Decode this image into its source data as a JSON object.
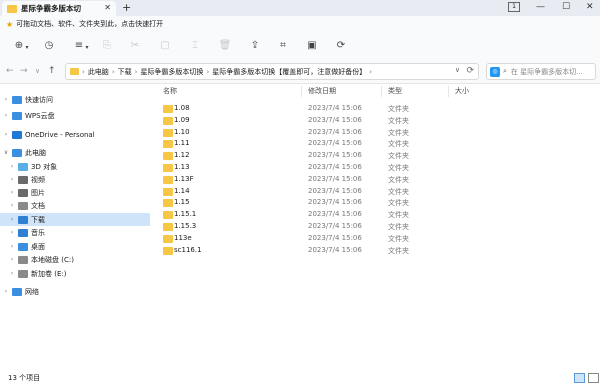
{
  "window": {
    "tab_title": "星际争霸多版本切",
    "tab_close": "✕",
    "new_tab": "+",
    "badge": "1",
    "minimize": "—",
    "maximize": "☐",
    "close": "✕"
  },
  "tip": {
    "text": "可拖动文档、软件、文件夹到此，点击快速打开"
  },
  "toolbar": {
    "icons": [
      "new-icon",
      "recent-icon",
      "view-icon",
      "copy-icon",
      "cut-icon",
      "paste-icon",
      "rename-icon",
      "delete-icon",
      "share-icon",
      "crop-icon",
      "save-icon",
      "refresh-icon"
    ]
  },
  "address": {
    "back": "←",
    "forward": "→",
    "dropdown": "∨",
    "up": "↑",
    "crumbs": [
      "此电脑",
      "下载",
      "星际争霸多版本切换",
      "星际争霸多版本切换【覆盖即可，注意做好备份】"
    ],
    "sep": "›",
    "search_placeholder": "在 星际争霸多版本切..."
  },
  "sidebar": {
    "items": [
      {
        "label": "快速访问",
        "level": 0,
        "icon": "star-icon",
        "color": "#3b8fe0"
      },
      {
        "label": "WPS云盘",
        "level": 0,
        "icon": "cloud-icon",
        "color": "#3b8fe0"
      },
      {
        "label": "OneDrive - Personal",
        "level": 0,
        "icon": "onedrive-icon",
        "color": "#1d7ad6"
      },
      {
        "label": "此电脑",
        "level": 0,
        "icon": "pc-icon",
        "color": "#3b8fe0",
        "expanded": true
      },
      {
        "label": "3D 对象",
        "level": 1,
        "icon": "3d-icon",
        "color": "#5ab0e6"
      },
      {
        "label": "视频",
        "level": 1,
        "icon": "video-icon",
        "color": "#6a6a6a"
      },
      {
        "label": "图片",
        "level": 1,
        "icon": "picture-icon",
        "color": "#6a6a6a"
      },
      {
        "label": "文档",
        "level": 1,
        "icon": "document-icon",
        "color": "#8a8a8a"
      },
      {
        "label": "下载",
        "level": 1,
        "icon": "download-icon",
        "color": "#2f7fd2",
        "selected": true
      },
      {
        "label": "音乐",
        "level": 1,
        "icon": "music-icon",
        "color": "#2f7fd2"
      },
      {
        "label": "桌面",
        "level": 1,
        "icon": "desktop-icon",
        "color": "#3b8fe0"
      },
      {
        "label": "本地磁盘 (C:)",
        "level": 1,
        "icon": "drive-icon",
        "color": "#8a8a8a"
      },
      {
        "label": "新加卷 (E:)",
        "level": 1,
        "icon": "drive-icon",
        "color": "#8a8a8a"
      },
      {
        "label": "网络",
        "level": 0,
        "icon": "network-icon",
        "color": "#3b8fe0"
      }
    ]
  },
  "columns": [
    "名称",
    "修改日期",
    "类型",
    "大小"
  ],
  "files": [
    {
      "name": "1.08",
      "date": "2023/7/4 15:06",
      "type": "文件夹"
    },
    {
      "name": "1.09",
      "date": "2023/7/4 15:06",
      "type": "文件夹"
    },
    {
      "name": "1.10",
      "date": "2023/7/4 15:06",
      "type": "文件夹"
    },
    {
      "name": "1.11",
      "date": "2023/7/4 15:06",
      "type": "文件夹"
    },
    {
      "name": "1.12",
      "date": "2023/7/4 15:06",
      "type": "文件夹"
    },
    {
      "name": "1.13",
      "date": "2023/7/4 15:06",
      "type": "文件夹"
    },
    {
      "name": "1.13F",
      "date": "2023/7/4 15:06",
      "type": "文件夹"
    },
    {
      "name": "1.14",
      "date": "2023/7/4 15:06",
      "type": "文件夹"
    },
    {
      "name": "1.15",
      "date": "2023/7/4 15:06",
      "type": "文件夹"
    },
    {
      "name": "1.15.1",
      "date": "2023/7/4 15:06",
      "type": "文件夹"
    },
    {
      "name": "1.15.3",
      "date": "2023/7/4 15:06",
      "type": "文件夹"
    },
    {
      "name": "113e",
      "date": "2023/7/4 15:06",
      "type": "文件夹"
    },
    {
      "name": "sc116.1",
      "date": "2023/7/4 15:06",
      "type": "文件夹"
    }
  ],
  "status": {
    "count": "13 个项目"
  }
}
